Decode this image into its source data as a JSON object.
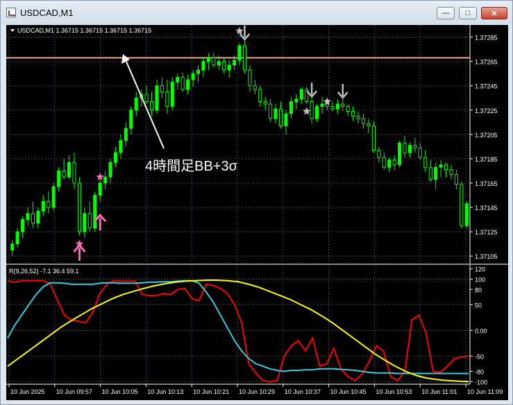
{
  "window": {
    "title": "USDCAD,M1",
    "buttons": {
      "minimize": "—",
      "maximize": "□",
      "close": "✕"
    }
  },
  "price_chart": {
    "info": "USDCAD,M1  1.36715 1.36715 1.36715 1.36715",
    "price_labels": [
      "1.37285",
      "1.37265",
      "1.37245",
      "1.37225",
      "1.37205",
      "1.37185",
      "1.37165",
      "1.37145",
      "1.37125",
      "1.37105"
    ],
    "annotation": "4時間足BB+3σ",
    "colors": {
      "bull": "#00ff00",
      "bear": "#000000",
      "bear_outline": "#00ff00",
      "hline": "#f4a582",
      "grid": "#5f6f7f"
    }
  },
  "indicator": {
    "label": "R(9,26,52) -7.1 36.4 59.1",
    "scale_labels": [
      "120",
      "100",
      "80",
      "50",
      "0.00",
      "-50",
      "-80",
      "-100"
    ],
    "colors": {
      "red": "#ff0000",
      "cyan": "#33d0e0",
      "yellow": "#ffff00"
    }
  },
  "time_labels": [
    "10 Jun 2025",
    "10 Jun 09:57",
    "10 Jun 10:05",
    "10 Jun 10:13",
    "10 Jun 10:21",
    "10 Jun 10:29",
    "10 Jun 10:37",
    "10 Jun 10:45",
    "10 Jun 10:53",
    "10 Jun 11:01",
    "10 Jun 11:09"
  ],
  "chart_data": [
    {
      "type": "candlestick",
      "symbol": "USDCAD",
      "timeframe": "M1",
      "y_range": [
        1.371,
        1.37295
      ],
      "candles": [
        [
          1.3711,
          1.37118,
          1.37105,
          1.37115
        ],
        [
          1.37115,
          1.37128,
          1.37112,
          1.37125
        ],
        [
          1.37125,
          1.37138,
          1.3712,
          1.37135
        ],
        [
          1.37135,
          1.37145,
          1.3713,
          1.3714
        ],
        [
          1.3714,
          1.3715,
          1.37128,
          1.37132
        ],
        [
          1.37132,
          1.37145,
          1.37128,
          1.37142
        ],
        [
          1.37142,
          1.37155,
          1.37138,
          1.3715
        ],
        [
          1.3715,
          1.37158,
          1.3714,
          1.37145
        ],
        [
          1.37145,
          1.37165,
          1.37142,
          1.37162
        ],
        [
          1.37162,
          1.37178,
          1.37158,
          1.37175
        ],
        [
          1.37175,
          1.37185,
          1.37168,
          1.3717
        ],
        [
          1.3717,
          1.37188,
          1.37168,
          1.37182
        ],
        [
          1.37182,
          1.3719,
          1.3716,
          1.37165
        ],
        [
          1.37165,
          1.3717,
          1.37122,
          1.37125
        ],
        [
          1.37125,
          1.37145,
          1.3712,
          1.3714
        ],
        [
          1.3714,
          1.3715,
          1.37125,
          1.37128
        ],
        [
          1.37128,
          1.37158,
          1.37125,
          1.37155
        ],
        [
          1.37155,
          1.37168,
          1.3715,
          1.37165
        ],
        [
          1.37165,
          1.37175,
          1.3716,
          1.3717
        ],
        [
          1.3717,
          1.37185,
          1.37165,
          1.37182
        ],
        [
          1.37182,
          1.37195,
          1.37178,
          1.3719
        ],
        [
          1.3719,
          1.37205,
          1.37185,
          1.372
        ],
        [
          1.372,
          1.37215,
          1.37195,
          1.3721
        ],
        [
          1.3721,
          1.37228,
          1.37205,
          1.37225
        ],
        [
          1.37225,
          1.3724,
          1.3722,
          1.37235
        ],
        [
          1.37235,
          1.37242,
          1.37228,
          1.37238
        ],
        [
          1.37238,
          1.37245,
          1.3723,
          1.37232
        ],
        [
          1.37232,
          1.3724,
          1.3722,
          1.37225
        ],
        [
          1.37225,
          1.3725,
          1.37222,
          1.37245
        ],
        [
          1.37245,
          1.37252,
          1.37235,
          1.3724
        ],
        [
          1.3724,
          1.3725,
          1.37222,
          1.37228
        ],
        [
          1.37228,
          1.37252,
          1.37225,
          1.37248
        ],
        [
          1.37248,
          1.37255,
          1.37242,
          1.37252
        ],
        [
          1.37252,
          1.37256,
          1.3724,
          1.37242
        ],
        [
          1.37242,
          1.37254,
          1.37238,
          1.3725
        ],
        [
          1.3725,
          1.37258,
          1.37244,
          1.37255
        ],
        [
          1.37255,
          1.37262,
          1.37248,
          1.37258
        ],
        [
          1.37258,
          1.37268,
          1.37252,
          1.37265
        ],
        [
          1.37265,
          1.37272,
          1.37258,
          1.37268
        ],
        [
          1.37268,
          1.37272,
          1.3726,
          1.37262
        ],
        [
          1.37262,
          1.3727,
          1.37258,
          1.37265
        ],
        [
          1.37265,
          1.37268,
          1.37255,
          1.37258
        ],
        [
          1.37258,
          1.37266,
          1.37252,
          1.37262
        ],
        [
          1.37262,
          1.3727,
          1.37258,
          1.37266
        ],
        [
          1.37266,
          1.3728,
          1.37262,
          1.37278
        ],
        [
          1.37278,
          1.37282,
          1.37255,
          1.37258
        ],
        [
          1.37258,
          1.37262,
          1.3724,
          1.37245
        ],
        [
          1.37245,
          1.3725,
          1.37238,
          1.37242
        ],
        [
          1.37242,
          1.37245,
          1.37228,
          1.37232
        ],
        [
          1.37232,
          1.37236,
          1.37225,
          1.3723
        ],
        [
          1.3723,
          1.37234,
          1.37215,
          1.37218
        ],
        [
          1.37218,
          1.3723,
          1.37214,
          1.37226
        ],
        [
          1.37226,
          1.37232,
          1.3721,
          1.37212
        ],
        [
          1.37212,
          1.37225,
          1.37205,
          1.37222
        ],
        [
          1.37222,
          1.37236,
          1.37218,
          1.37232
        ],
        [
          1.37232,
          1.37238,
          1.37226,
          1.37234
        ],
        [
          1.37234,
          1.37244,
          1.3723,
          1.37242
        ],
        [
          1.37242,
          1.37244,
          1.3723,
          1.37232
        ],
        [
          1.37232,
          1.37235,
          1.37214,
          1.37218
        ],
        [
          1.37218,
          1.3723,
          1.37215,
          1.37228
        ],
        [
          1.37228,
          1.37236,
          1.37222,
          1.3723
        ],
        [
          1.3723,
          1.37235,
          1.37225,
          1.37228
        ],
        [
          1.37228,
          1.37232,
          1.37224,
          1.37226
        ],
        [
          1.37226,
          1.37234,
          1.37222,
          1.3723
        ],
        [
          1.3723,
          1.37234,
          1.37224,
          1.37228
        ],
        [
          1.37228,
          1.3723,
          1.3722,
          1.37224
        ],
        [
          1.37224,
          1.37228,
          1.37216,
          1.3722
        ],
        [
          1.3722,
          1.37224,
          1.37214,
          1.37218
        ],
        [
          1.37218,
          1.37222,
          1.3721,
          1.37214
        ],
        [
          1.37214,
          1.37218,
          1.37206,
          1.37212
        ],
        [
          1.37212,
          1.37216,
          1.3719,
          1.37192
        ],
        [
          1.37192,
          1.37195,
          1.37182,
          1.37186
        ],
        [
          1.37186,
          1.3719,
          1.37176,
          1.37178
        ],
        [
          1.37178,
          1.37186,
          1.37174,
          1.37184
        ],
        [
          1.37184,
          1.37188,
          1.37176,
          1.3718
        ],
        [
          1.3718,
          1.372,
          1.37178,
          1.37198
        ],
        [
          1.37198,
          1.37204,
          1.37186,
          1.3719
        ],
        [
          1.3719,
          1.37198,
          1.37186,
          1.37196
        ],
        [
          1.37196,
          1.37202,
          1.3719,
          1.37194
        ],
        [
          1.37194,
          1.37198,
          1.37184,
          1.37186
        ],
        [
          1.37186,
          1.37192,
          1.37174,
          1.37178
        ],
        [
          1.37178,
          1.37184,
          1.37166,
          1.37168
        ],
        [
          1.37168,
          1.37182,
          1.3716,
          1.37178
        ],
        [
          1.37178,
          1.37184,
          1.3717,
          1.3718
        ],
        [
          1.3718,
          1.37182,
          1.3717,
          1.37176
        ],
        [
          1.37176,
          1.3718,
          1.37168,
          1.37172
        ],
        [
          1.37172,
          1.37176,
          1.3716,
          1.37164
        ],
        [
          1.37164,
          1.37166,
          1.37128,
          1.3713
        ],
        [
          1.3713,
          1.3715,
          1.37128,
          1.37148
        ]
      ],
      "hline": 1.37268,
      "signal_arrows": [
        {
          "index": 13,
          "dir": "up",
          "color": "#ff69b4"
        },
        {
          "index": 17,
          "dir": "up",
          "color": "#ff69b4"
        },
        {
          "index": 45,
          "dir": "down",
          "color": "#c0c0c0"
        },
        {
          "index": 58,
          "dir": "down",
          "color": "#c0c0c0"
        },
        {
          "index": 64,
          "dir": "down",
          "color": "#c0c0c0"
        }
      ],
      "signal_stars": [
        {
          "index": 13,
          "price": 1.37115,
          "color": "#ff69b4"
        },
        {
          "index": 17,
          "price": 1.3717,
          "color": "#ff69b4"
        },
        {
          "index": 44,
          "price": 1.3729,
          "color": "#c0c0c0"
        },
        {
          "index": 57,
          "price": 1.37224,
          "color": "#c0c0c0"
        },
        {
          "index": 61,
          "price": 1.37232,
          "color": "#c0c0c0"
        }
      ]
    },
    {
      "type": "line",
      "ylim": [
        -105,
        125
      ],
      "series": [
        {
          "color": "#ff0000",
          "values": [
            97,
            94,
            97,
            97,
            97,
            97,
            91,
            60,
            30,
            20,
            18,
            15,
            35,
            72,
            90,
            97,
            96,
            96,
            96,
            70,
            68,
            68,
            72,
            70,
            80,
            82,
            62,
            58,
            90,
            88,
            82,
            72,
            50,
            15,
            -65,
            -83,
            -98,
            -100,
            -98,
            -50,
            -30,
            -20,
            -40,
            -15,
            -70,
            -65,
            -35,
            -75,
            -90,
            -98,
            -85,
            -60,
            -30,
            -40,
            -90,
            -98,
            -80,
            20,
            30,
            -5,
            -80,
            -82,
            -70,
            -55,
            -52,
            -50
          ]
        },
        {
          "color": "#33d0e0",
          "values": [
            -15,
            10,
            30,
            50,
            70,
            85,
            93,
            93,
            92,
            90,
            90,
            90,
            90,
            92,
            93,
            93,
            92,
            92,
            92,
            93,
            94,
            94,
            95,
            95,
            96,
            97,
            97,
            92,
            75,
            55,
            30,
            5,
            -20,
            -40,
            -55,
            -65,
            -70,
            -75,
            -78,
            -80,
            -78,
            -78,
            -77,
            -77,
            -75,
            -75,
            -75,
            -76,
            -77,
            -78,
            -80,
            -82,
            -83,
            -83,
            -83,
            -84,
            -84,
            -84,
            -84,
            -84,
            -84,
            -84,
            -84,
            -84,
            -84,
            -84
          ]
        },
        {
          "color": "#ffff00",
          "values": [
            -70,
            -55,
            -40,
            -25,
            -10,
            5,
            18,
            30,
            42,
            52,
            62,
            70,
            76,
            82,
            87,
            91,
            94,
            96,
            97,
            98,
            98,
            97,
            95,
            90,
            84,
            76,
            68,
            60,
            50,
            40,
            28,
            15,
            0,
            -15,
            -30,
            -45,
            -58,
            -70,
            -80,
            -88,
            -93,
            -96,
            -98,
            -99,
            -100
          ]
        }
      ]
    }
  ]
}
